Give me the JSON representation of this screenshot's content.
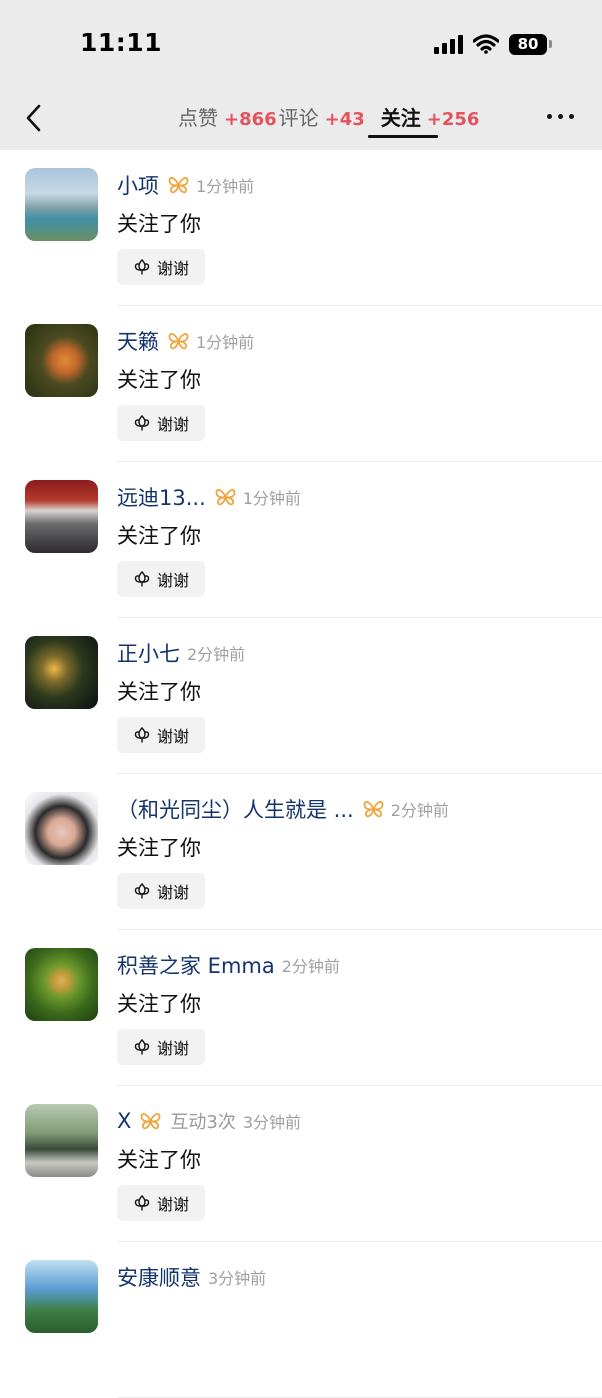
{
  "status_bar": {
    "time": "11:11",
    "battery": "80"
  },
  "nav": {
    "tabs": [
      {
        "label": "点赞",
        "count": "+866",
        "active": false
      },
      {
        "label": "评论",
        "count": "+43",
        "active": false
      },
      {
        "label": "关注",
        "count": "+256",
        "active": true
      }
    ]
  },
  "items": [
    {
      "name": "小项",
      "vip": true,
      "extra": "",
      "time": "1分钟前",
      "action": "关注了你",
      "thanks_label": "谢谢"
    },
    {
      "name": "天籁",
      "vip": true,
      "extra": "",
      "time": "1分钟前",
      "action": "关注了你",
      "thanks_label": "谢谢"
    },
    {
      "name": "远迪13...",
      "vip": true,
      "extra": "",
      "time": "1分钟前",
      "action": "关注了你",
      "thanks_label": "谢谢"
    },
    {
      "name": "正小七",
      "vip": false,
      "extra": "",
      "time": "2分钟前",
      "action": "关注了你",
      "thanks_label": "谢谢"
    },
    {
      "name": "（和光同尘）人生就是 ...",
      "vip": true,
      "extra": "",
      "time": "2分钟前",
      "action": "关注了你",
      "thanks_label": "谢谢"
    },
    {
      "name": "积善之家 Emma",
      "vip": false,
      "extra": "",
      "time": "2分钟前",
      "action": "关注了你",
      "thanks_label": "谢谢"
    },
    {
      "name": "X",
      "vip": true,
      "extra": "互动3次",
      "time": "3分钟前",
      "action": "关注了你",
      "thanks_label": "谢谢"
    },
    {
      "name": "安康顺意",
      "vip": false,
      "extra": "",
      "time": "3分钟前",
      "action": "",
      "thanks_label": ""
    }
  ],
  "colors": {
    "accent_count": "#e5525e",
    "name_blue": "#15346d",
    "vip_gold": "#f0a640"
  },
  "icons": {
    "back": "chevron-left-icon",
    "more": "more-dots-icon",
    "vip": "vip-butterfly-icon",
    "thanks": "flower-icon",
    "signal": "cellular-signal-icon",
    "wifi": "wifi-icon",
    "battery": "battery-icon"
  }
}
